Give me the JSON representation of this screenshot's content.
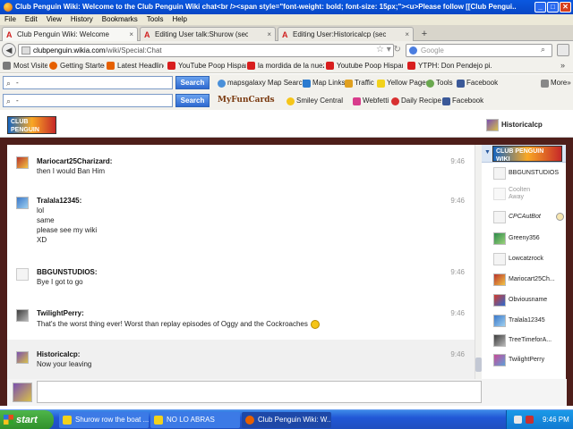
{
  "window": {
    "title": "Club Penguin Wiki: Welcome to the Club Penguin Wiki chat<br /><span style=\"font-weight: bold; font-size: 15px;\"><u>Please follow [[Club Pengui...",
    "controls": {
      "minimize": "_",
      "maximize": "□",
      "close": "✕"
    }
  },
  "menu": [
    "File",
    "Edit",
    "View",
    "History",
    "Bookmarks",
    "Tools",
    "Help"
  ],
  "tabs": [
    {
      "label": "Club Penguin Wiki: Welcome to the Club ...",
      "icon": "wikia-icon",
      "active": true
    },
    {
      "label": "Editing User talk:Shurow (section) - Club ...",
      "icon": "wikia-icon",
      "active": false
    },
    {
      "label": "Editing User:Historicalcp (section) - Club ...",
      "icon": "wikia-icon",
      "active": false
    }
  ],
  "newtab": "+",
  "nav": {
    "url_host": "clubpenguin.wikia.com",
    "url_path": "/wiki/Special:Chat",
    "search_placeholder": "Google"
  },
  "bookmarks": [
    {
      "label": "Most Visited",
      "color": "#7a7a7a"
    },
    {
      "label": "Getting Started",
      "color": "#e66000"
    },
    {
      "label": "Latest Headlines",
      "color": "#e66000"
    },
    {
      "label": "YouTube Poop Hispan...",
      "color": "#d81e1e"
    },
    {
      "label": "la mordida de la nuez ...",
      "color": "#d81e1e"
    },
    {
      "label": "Youtube Poop Hispan...",
      "color": "#d81e1e"
    },
    {
      "label": "YTPH: Don Pendejo pi...",
      "color": "#d81e1e"
    }
  ],
  "toolbar1": {
    "input_value": "-",
    "search_label": "Search",
    "items": [
      {
        "label": "mapsgalaxy Map Search",
        "color": "#4a90d9"
      },
      {
        "label": "Map Links",
        "color": "#2b7bd0"
      },
      {
        "label": "Traffic",
        "color": "#e0a020"
      },
      {
        "label": "Yellow Pages",
        "color": "#f2d21c"
      },
      {
        "label": "Tools",
        "color": "#6aa84f"
      },
      {
        "label": "Facebook",
        "color": "#3b5998"
      },
      {
        "label": "More»",
        "color": "#888888"
      }
    ]
  },
  "toolbar2": {
    "input_value": "-",
    "search_label": "Search",
    "brand": "MyFunCards",
    "items": [
      {
        "label": "Smiley Central",
        "color": "#f5c518"
      },
      {
        "label": "Webfetti",
        "color": "#d83c8c"
      },
      {
        "label": "Daily Recipe",
        "color": "#d83030"
      },
      {
        "label": "Facebook",
        "color": "#3b5998"
      }
    ]
  },
  "chat": {
    "logo_text": "CLUB PENGUIN WIKI",
    "current_user": "Historicalcp",
    "messages": [
      {
        "user": "Mariocart25Charizard:",
        "lines": [
          "then I would Ban Him"
        ],
        "time": "9:46",
        "avatar": "c4",
        "self": false
      },
      {
        "user": "Tralala12345:",
        "lines": [
          "lol",
          "same",
          "please see my wiki",
          "XD"
        ],
        "time": "9:46",
        "avatar": "c2",
        "self": false
      },
      {
        "user": "BBGUNSTUDIOS:",
        "lines": [
          "Bye I got to go"
        ],
        "time": "9:46",
        "avatar": "c3",
        "self": false
      },
      {
        "user": "TwilightPerry:",
        "lines": [
          "That's the worst thing ever! Worst than replay episodes of Oggy and the Cockroaches"
        ],
        "time": "9:46",
        "avatar": "c7",
        "self": false,
        "smiley": true
      },
      {
        "user": "Historicalcp:",
        "lines": [
          "Now your leaving"
        ],
        "time": "9:46",
        "avatar": "c1",
        "self": true
      }
    ],
    "users": [
      {
        "name": "BBGUNSTUDIOS",
        "status": "",
        "avatar": "c3"
      },
      {
        "name": "Coolten",
        "status": "Away",
        "avatar": "c3",
        "away": true
      },
      {
        "name": "CPCAutBot",
        "status": "",
        "avatar": "c3",
        "bot": true
      },
      {
        "name": "Greeny356",
        "status": "",
        "avatar": "c6"
      },
      {
        "name": "Lowcatzrock",
        "status": "",
        "avatar": "c3"
      },
      {
        "name": "Mariocart25Ch...",
        "status": "",
        "avatar": "c4"
      },
      {
        "name": "Obviousname",
        "status": "",
        "avatar": "c8"
      },
      {
        "name": "Tralala12345",
        "status": "",
        "avatar": "c2"
      },
      {
        "name": "TreeTimeforA...",
        "status": "",
        "avatar": "c7"
      },
      {
        "name": "TwilightPerry",
        "status": "",
        "avatar": "c5"
      }
    ]
  },
  "taskbar": {
    "start": "start",
    "buttons": [
      {
        "label": "Shurow row the boat ...",
        "color": "#f2d21c"
      },
      {
        "label": "NO LO ABRAS",
        "color": "#f2d21c"
      },
      {
        "label": "Club Penguin Wiki: W...",
        "color": "#e66000"
      }
    ],
    "clock": "9:46 PM"
  }
}
